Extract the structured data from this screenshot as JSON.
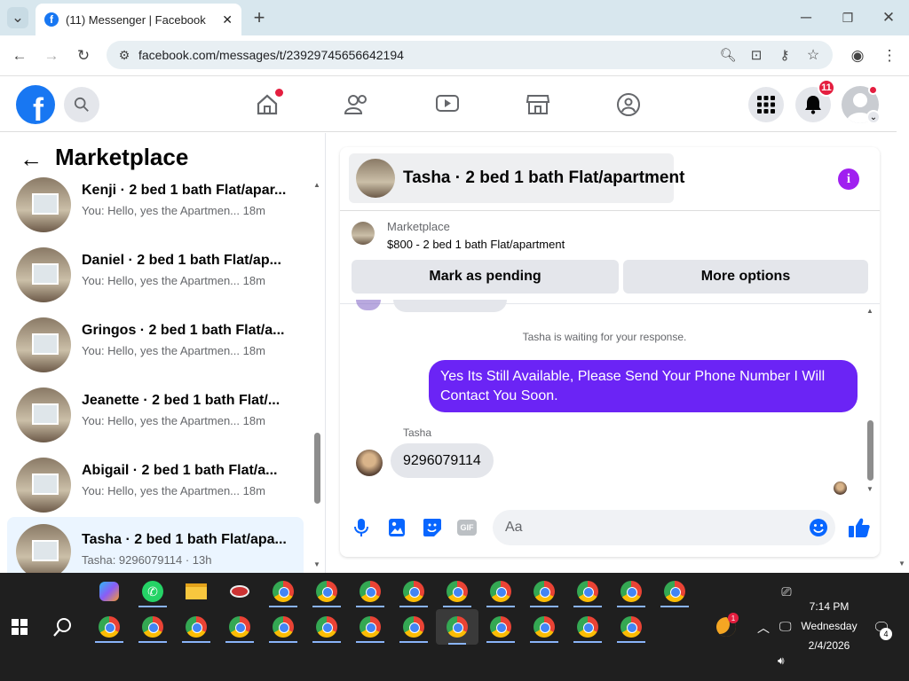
{
  "browser": {
    "tab_title": "(11) Messenger | Facebook",
    "url": "facebook.com/messages/t/23929745656642194"
  },
  "fb_header": {
    "notification_count": "11"
  },
  "left": {
    "title": "Marketplace",
    "conversations": [
      {
        "name": "Kenji · 2 bed 1 bath Flat/apar...",
        "preview": "You: Hello, yes the Apartmen...",
        "time": "18m"
      },
      {
        "name": "Daniel · 2 bed 1 bath Flat/ap...",
        "preview": "You: Hello, yes the Apartmen...",
        "time": "18m"
      },
      {
        "name": "Gringos · 2 bed 1 bath Flat/a...",
        "preview": "You: Hello, yes the Apartmen...",
        "time": "18m"
      },
      {
        "name": "Jeanette · 2 bed 1 bath Flat/...",
        "preview": "You: Hello, yes the Apartmen...",
        "time": "18m"
      },
      {
        "name": "Abigail · 2 bed 1 bath Flat/a...",
        "preview": "You: Hello, yes the Apartmen...",
        "time": "18m"
      },
      {
        "name": "Tasha · 2 bed 1 bath Flat/apa...",
        "preview": "Tasha: 9296079114 · 13h",
        "time": ""
      }
    ]
  },
  "chat": {
    "header_title": "Tasha · 2 bed 1 bath Flat/apartment",
    "listing_source": "Marketplace",
    "listing_title": "$800 - 2 bed 1 bath Flat/apartment",
    "mark_pending": "Mark as pending",
    "more_options": "More options",
    "waiting_text": "Tasha is waiting for your response.",
    "my_message": "Yes Its Still Available, Please Send Your Phone Number I Will Contact You Soon.",
    "sender_name": "Tasha",
    "their_message": "9296079114",
    "input_placeholder": "Aa"
  },
  "taskbar": {
    "time": "7:14 PM",
    "day": "Wednesday",
    "date": "2/4/2026",
    "notif_count": "4",
    "tray_badge": "1"
  },
  "colors": {
    "accent": "#1877f2",
    "my_bubble": "#6b24f5",
    "selected_row": "#ebf5ff"
  }
}
